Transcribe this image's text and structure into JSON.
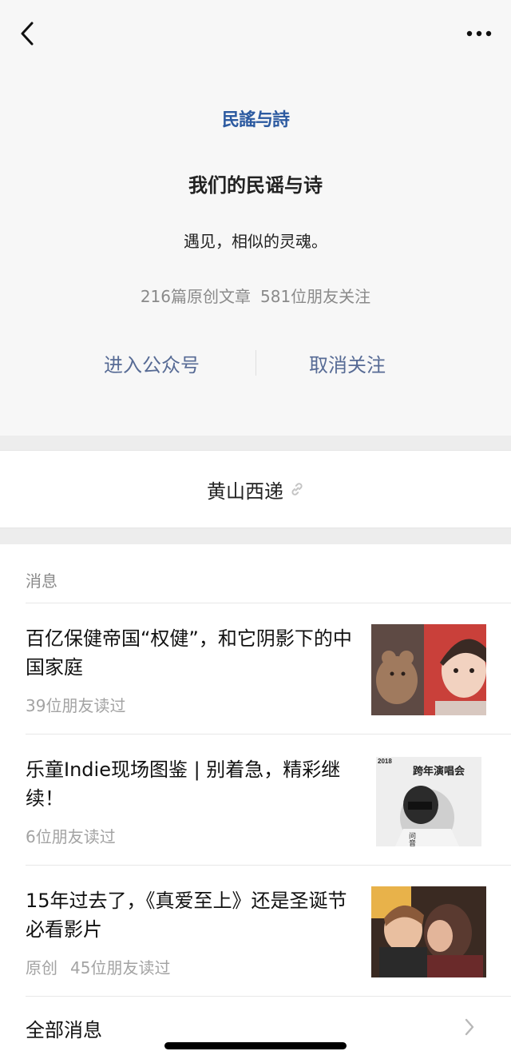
{
  "nav": {
    "back_icon": "chevron-left-icon",
    "more_icon": "more-dots-icon"
  },
  "account": {
    "logo_text": "民謠与詩",
    "name": "我们的民谣与诗",
    "description": "遇见，相似的灵魂。",
    "stats": {
      "articles": "216篇原创文章",
      "followers": "581位朋友关注"
    },
    "enter_label": "进入公众号",
    "unfollow_label": "取消关注"
  },
  "location": {
    "text": "黄山西递",
    "icon": "link-icon"
  },
  "messages": {
    "section_title": "消息",
    "items": [
      {
        "title": "百亿保健帝国“权健”，和它阴影下的中国家庭",
        "original": "",
        "reads": "39位朋友读过",
        "thumb": "child-with-teddy-bear"
      },
      {
        "title": "乐童Indie现场图鉴 | 别着急，精彩继续！",
        "original": "",
        "reads": "6位朋友读过",
        "thumb": "concert-poster",
        "thumb_text": {
          "year": "2018",
          "headline": "跨年演唱会",
          "side": "问音哥"
        }
      },
      {
        "title": "15年过去了，《真爱至上》还是圣诞节必看影片",
        "original": "原创",
        "reads": "45位朋友读过",
        "thumb": "film-still-kiss"
      }
    ],
    "all_label": "全部消息"
  },
  "colors": {
    "link_blue": "#576b95",
    "profile_bg": "#f7f7f7",
    "gap_bg": "#ededed",
    "muted_text": "#8a8a8a"
  }
}
